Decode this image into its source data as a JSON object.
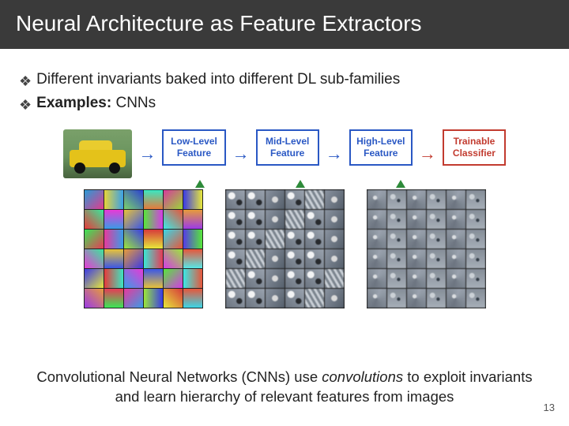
{
  "title": "Neural Architecture as Feature Extractors",
  "bullets": {
    "b1": "Different invariants baked into different DL sub-families",
    "b2_label": "Examples:",
    "b2_rest": " CNNs"
  },
  "flow": {
    "box1_l1": "Low-Level",
    "box1_l2": "Feature",
    "box2_l1": "Mid-Level",
    "box2_l2": "Feature",
    "box3_l1": "High-Level",
    "box3_l2": "Feature",
    "box4_l1": "Trainable",
    "box4_l2": "Classifier"
  },
  "caption": {
    "part1": "Convolutional Neural Networks (CNNs) use ",
    "emph": "convolutions",
    "part2": " to exploit invariants and learn hierarchy of relevant features from images"
  },
  "page_number": "13"
}
